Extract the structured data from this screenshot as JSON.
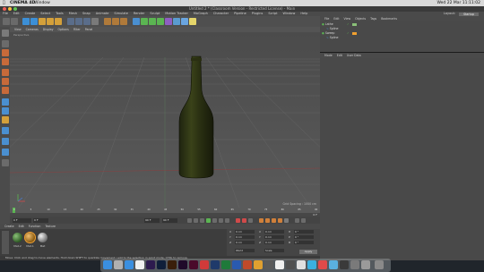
{
  "mac_menubar": {
    "app": "CINEMA 4D",
    "items": [
      "Window"
    ],
    "clock": "Wed 22 Mar  11:11:02"
  },
  "window": {
    "title": "Untitled 2 * (Classroom Version - Restricted License) - Main"
  },
  "c4d_menu": {
    "items": [
      "File",
      "Edit",
      "Create",
      "Select",
      "Tools",
      "Mesh",
      "Snap",
      "Animate",
      "Simulate",
      "Render",
      "Sculpt",
      "Motion Tracker",
      "MoGraph",
      "Character",
      "Pipeline",
      "Plugins",
      "Script",
      "Window",
      "Help"
    ],
    "layout_label": "Layout:",
    "layout_value": "Startup"
  },
  "viewport": {
    "menu": [
      "View",
      "Cameras",
      "Display",
      "Options",
      "Filter",
      "Panel"
    ],
    "camera_label": "Perspective",
    "grid_spacing": "Grid Spacing : 1000 cm"
  },
  "timeline": {
    "ticks": [
      "0",
      "5",
      "10",
      "15",
      "20",
      "25",
      "30",
      "35",
      "40",
      "45",
      "50",
      "55",
      "60",
      "65",
      "70",
      "75",
      "80",
      "85",
      "90"
    ],
    "current_frame": "0 F",
    "start_field": "0 F",
    "end_field": "90 F",
    "end_field2": "90 F",
    "current_readout": "0 F"
  },
  "material_manager": {
    "menu": [
      "Create",
      "Edit",
      "Function",
      "Texture"
    ],
    "materials": [
      "Mat.2",
      "Mat.1",
      "Mat"
    ]
  },
  "coordinates": {
    "rows": [
      {
        "axis": "X",
        "pos": "0 cm",
        "x2": "X",
        "size": "0 cm",
        "h": "H",
        "rot": "0 °"
      },
      {
        "axis": "Y",
        "pos": "0 cm",
        "x2": "Y",
        "size": "0 cm",
        "h": "P",
        "rot": "0 °"
      },
      {
        "axis": "Z",
        "pos": "0 cm",
        "x2": "Z",
        "size": "0 cm",
        "h": "B",
        "rot": "0 °"
      }
    ],
    "mode1": "World",
    "mode2": "Scale",
    "apply": "Apply"
  },
  "status": "Move: Click and drag to move elements. Hold down SHIFT to quantize movement / add to the selection in point mode, CTRL to remove.",
  "object_manager": {
    "menu": [
      "File",
      "Edit",
      "View",
      "Objects",
      "Tags",
      "Bookmarks"
    ],
    "objects": [
      "Lathe",
      "Spline",
      "Sweep",
      "Spline"
    ]
  },
  "attributes": {
    "menu": [
      "Mode",
      "Edit",
      "User Data"
    ]
  },
  "colors": {
    "bottle": "#2d3213",
    "accent": "#f0a030"
  }
}
